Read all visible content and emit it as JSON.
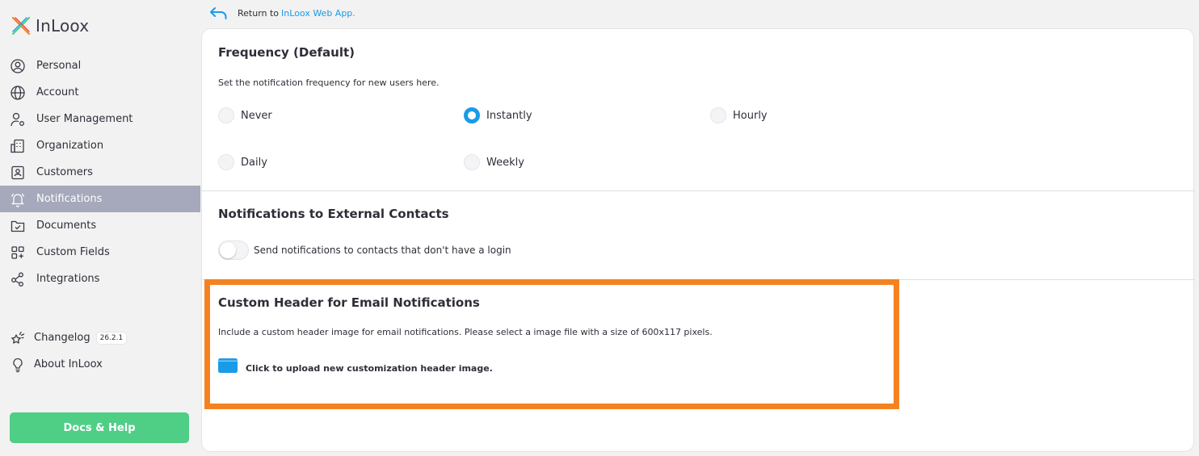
{
  "app": {
    "name": "InLoox"
  },
  "sidebar": {
    "items": [
      {
        "label": "Personal",
        "icon": "user-circle-icon",
        "active": false
      },
      {
        "label": "Account",
        "icon": "globe-icon",
        "active": false
      },
      {
        "label": "User Management",
        "icon": "user-settings-icon",
        "active": false
      },
      {
        "label": "Organization",
        "icon": "building-icon",
        "active": false
      },
      {
        "label": "Customers",
        "icon": "contact-card-icon",
        "active": false
      },
      {
        "label": "Notifications",
        "icon": "bell-icon",
        "active": true
      },
      {
        "label": "Documents",
        "icon": "folder-check-icon",
        "active": false
      },
      {
        "label": "Custom Fields",
        "icon": "grid-add-icon",
        "active": false
      },
      {
        "label": "Integrations",
        "icon": "share-nodes-icon",
        "active": false
      }
    ],
    "bottom": {
      "changelog_label": "Changelog",
      "version": "26.2.1",
      "about_label": "About InLoox"
    },
    "docs_button": "Docs & Help"
  },
  "top": {
    "return_text": "Return to",
    "return_link": "InLoox Web App."
  },
  "frequency": {
    "title": "Frequency (Default)",
    "description": "Set the notification frequency for new users here.",
    "options": [
      {
        "label": "Never",
        "checked": false
      },
      {
        "label": "Instantly",
        "checked": true
      },
      {
        "label": "Hourly",
        "checked": false
      },
      {
        "label": "Daily",
        "checked": false
      },
      {
        "label": "Weekly",
        "checked": false
      }
    ]
  },
  "external": {
    "title": "Notifications to External Contacts",
    "toggle_label": "Send notifications to contacts that don't have a login",
    "toggle_on": false
  },
  "custom_header": {
    "title": "Custom Header for Email Notifications",
    "description": "Include a custom header image for email notifications. Please select a image file with a size of 600x117 pixels.",
    "upload_label": "Click to upload new customization header image."
  },
  "colors": {
    "accent": "#1a9be8",
    "active_nav": "#a6a8bb",
    "docs_button": "#4fcf86",
    "highlight": "#f58220"
  }
}
